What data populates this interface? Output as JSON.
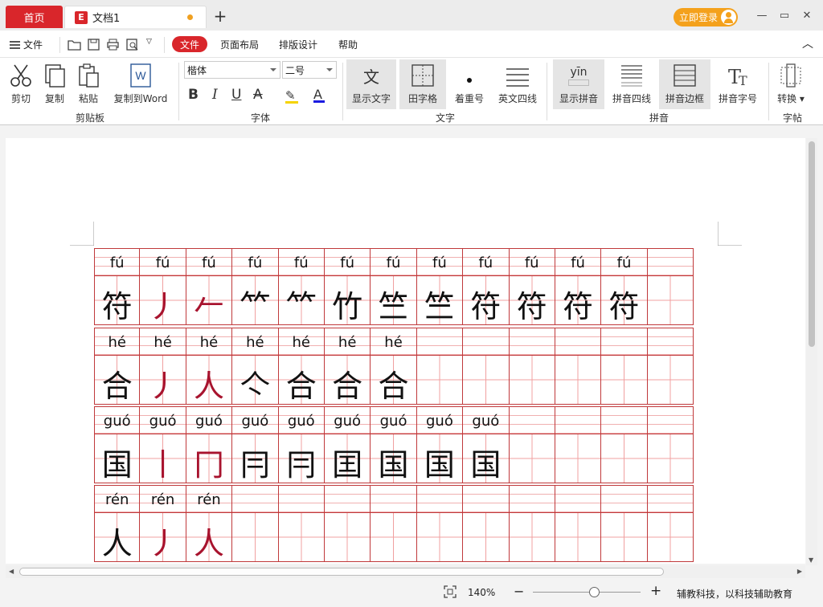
{
  "tabs": {
    "home": "首页",
    "doc_title": "文档1",
    "new": "+"
  },
  "login": "立即登录",
  "menu": {
    "file_menu": "文件",
    "active_tab": "文件",
    "tabs": [
      "页面布局",
      "排版设计",
      "帮助"
    ]
  },
  "ribbon": {
    "clipboard": {
      "items": [
        "剪切",
        "复制",
        "粘贴",
        "复制到Word"
      ],
      "group": "剪贴板"
    },
    "font": {
      "family": "楷体",
      "size": "二号",
      "group": "字体"
    },
    "text": {
      "items": [
        "显示文字",
        "田字格",
        "着重号",
        "英文四线"
      ],
      "group": "文字"
    },
    "pinyin": {
      "items": [
        "显示拼音",
        "拼音四线",
        "拼音边框",
        "拼音字号"
      ],
      "group": "拼音",
      "icon_text": "yīn"
    },
    "post": {
      "items": [
        "转换"
      ],
      "group": "字帖"
    },
    "text_icon": "文"
  },
  "worksheet": {
    "rows": [
      {
        "pinyin": [
          "fú",
          "fú",
          "fú",
          "fú",
          "fú",
          "fú",
          "fú",
          "fú",
          "fú",
          "fú",
          "fú",
          "fú",
          ""
        ],
        "chars": [
          "符",
          "丿",
          "𠂉",
          "⺮",
          "⺮",
          "竹",
          "竺",
          "竺",
          "符",
          "符",
          "符",
          "符",
          ""
        ]
      },
      {
        "pinyin": [
          "hé",
          "hé",
          "hé",
          "hé",
          "hé",
          "hé",
          "hé",
          "",
          "",
          "",
          "",
          "",
          ""
        ],
        "chars": [
          "合",
          "丿",
          "人",
          "亽",
          "合",
          "合",
          "合",
          "",
          "",
          "",
          "",
          "",
          ""
        ]
      },
      {
        "pinyin": [
          "guó",
          "guó",
          "guó",
          "guó",
          "guó",
          "guó",
          "guó",
          "guó",
          "guó",
          "",
          "",
          "",
          ""
        ],
        "chars": [
          "国",
          "丨",
          "冂",
          "冃",
          "冃",
          "囯",
          "国",
          "国",
          "国",
          "",
          "",
          "",
          ""
        ]
      },
      {
        "pinyin": [
          "rén",
          "rén",
          "rén",
          "",
          "",
          "",
          "",
          "",
          "",
          "",
          "",
          "",
          ""
        ],
        "chars": [
          "人",
          "丿",
          "人",
          "",
          "",
          "",
          "",
          "",
          "",
          "",
          "",
          "",
          ""
        ]
      }
    ]
  },
  "status": {
    "zoom": "140%",
    "minus": "−",
    "plus": "+",
    "brand": "辅教科技，以科技辅助教育"
  }
}
